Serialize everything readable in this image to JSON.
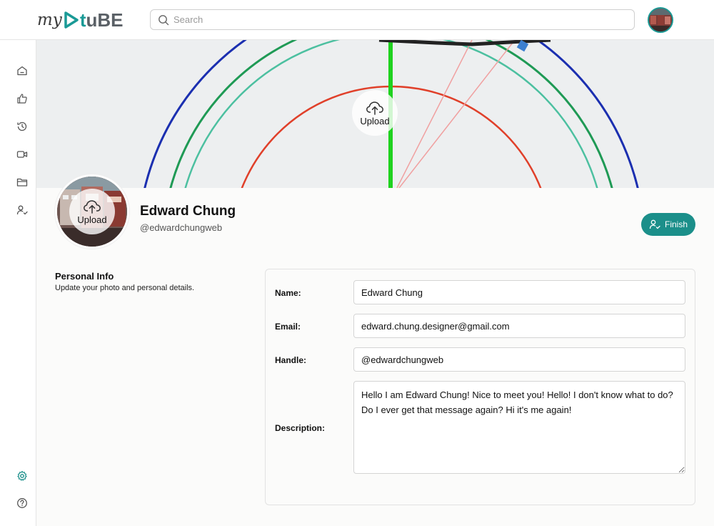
{
  "header": {
    "logo": {
      "prefix": "my",
      "t": "t",
      "rest": "uBE"
    },
    "search": {
      "placeholder": "Search",
      "value": ""
    }
  },
  "sidebar": {
    "items": [
      {
        "icon": "home-icon"
      },
      {
        "icon": "thumbs-up-icon"
      },
      {
        "icon": "history-icon"
      },
      {
        "icon": "video-icon"
      },
      {
        "icon": "folder-icon"
      },
      {
        "icon": "user-check-icon"
      }
    ],
    "bottom": [
      {
        "icon": "settings-icon",
        "active": true
      },
      {
        "icon": "help-icon"
      }
    ]
  },
  "banner": {
    "upload_label": "Upload"
  },
  "profile": {
    "upload_label": "Upload",
    "name": "Edward Chung",
    "handle": "@edwardchungweb",
    "finish_label": "Finish"
  },
  "personal_info": {
    "title": "Personal Info",
    "subtitle": "Update your photo and personal details."
  },
  "form": {
    "name_label": "Name:",
    "name_value": "Edward Chung",
    "email_label": "Email:",
    "email_value": "edward.chung.designer@gmail.com",
    "handle_label": "Handle:",
    "handle_value": "@edwardchungweb",
    "description_label": "Description:",
    "description_value": "Hello I am Edward Chung! Nice to meet you! Hello! I don't know what to do? Do I ever get that message again? Hi it's me again!"
  },
  "colors": {
    "accent": "#1b8f8a"
  }
}
